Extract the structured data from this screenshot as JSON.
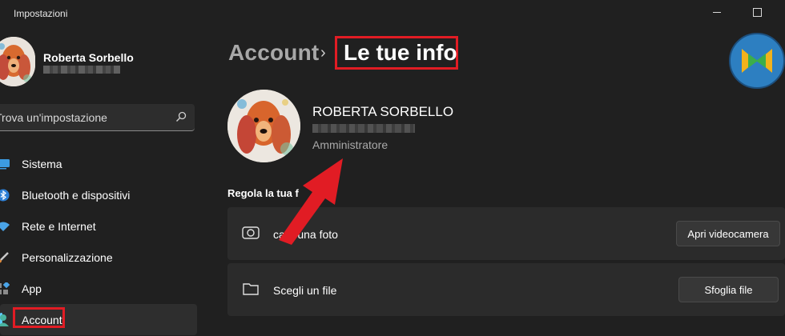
{
  "window": {
    "title": "Impostazioni"
  },
  "sidebar": {
    "user_name": "Roberta Sorbello",
    "search_placeholder": "Trova un'impostazione",
    "items": [
      {
        "label": "Sistema",
        "icon": "monitor-icon"
      },
      {
        "label": "Bluetooth e dispositivi",
        "icon": "bluetooth-icon"
      },
      {
        "label": "Rete e Internet",
        "icon": "wifi-icon"
      },
      {
        "label": "Personalizzazione",
        "icon": "brush-icon"
      },
      {
        "label": "App",
        "icon": "apps-icon"
      },
      {
        "label": "Account",
        "icon": "account-icon",
        "active": true
      }
    ]
  },
  "breadcrumb": {
    "parent": "Account",
    "separator": "›",
    "current": "Le tue info"
  },
  "profile": {
    "name": "ROBERTA SORBELLO",
    "role": "Amministratore"
  },
  "photo_section": {
    "title": "Regola la tua f",
    "rows": [
      {
        "label": "cata una foto",
        "icon": "camera-icon",
        "button": "Apri videocamera"
      },
      {
        "label": "Scegli un file",
        "icon": "folder-icon",
        "button": "Sfoglia file"
      }
    ]
  },
  "colors": {
    "accent": "#60cdff",
    "highlight_red": "#e11c24",
    "background": "#202020",
    "card": "#2b2b2b"
  }
}
